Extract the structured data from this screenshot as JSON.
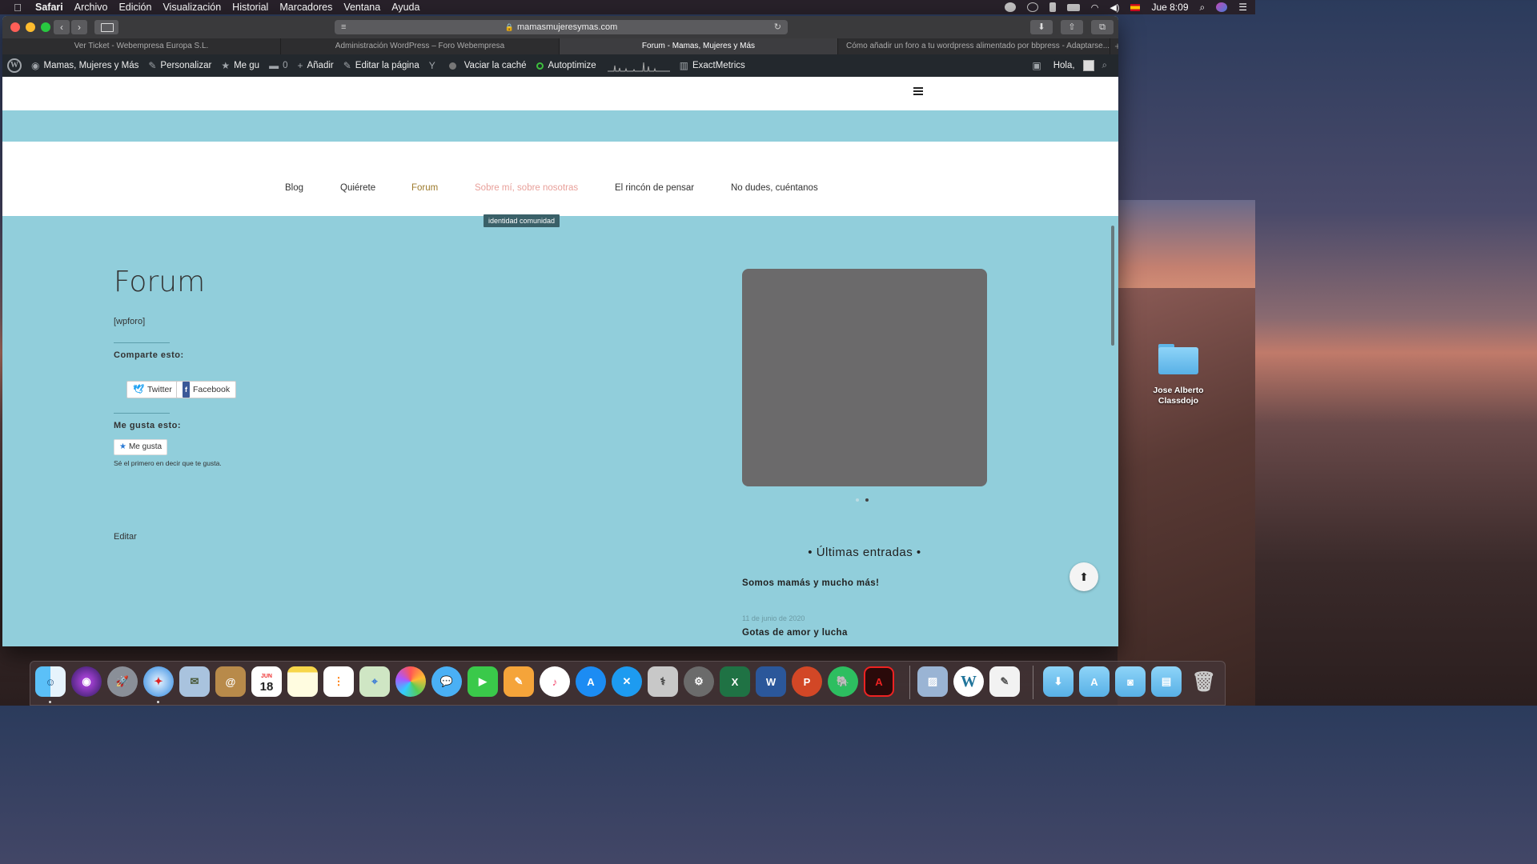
{
  "menubar": {
    "apple": "",
    "items": [
      "Safari",
      "Archivo",
      "Edición",
      "Visualización",
      "Historial",
      "Marcadores",
      "Ventana",
      "Ayuda"
    ],
    "clock": "Jue 8:09"
  },
  "browser": {
    "address": "mamasmujeresymas.com",
    "tabs": [
      {
        "label": "Ver Ticket - Webempresa Europa S.L."
      },
      {
        "label": "Administración WordPress – Foro Webempresa"
      },
      {
        "label": "Forum - Mamas, Mujeres y Más"
      },
      {
        "label": "Cómo añadir un foro a tu wordpress alimentado por bbpress - Adaptarse..."
      }
    ],
    "active_tab": 2
  },
  "wpbar": {
    "site": "Mamas, Mujeres y Más",
    "customize": "Personalizar",
    "me_gusta": "Me gu",
    "comments": "0",
    "add": "Añadir",
    "edit_page": "Editar la página",
    "clear_cache": "Vaciar la caché",
    "autoptimize": "Autoptimize",
    "exactmetrics": "ExactMetrics",
    "hello": "Hola,"
  },
  "nav": {
    "items": [
      "Blog",
      "Quiérete",
      "Forum",
      "Sobre mí, sobre nosotras",
      "El rincón de pensar",
      "No dudes, cuéntanos"
    ],
    "tooltip": "identidad comunidad"
  },
  "content": {
    "title": "Forum",
    "shortcode": "[wpforo]",
    "share_heading": "Comparte esto:",
    "twitter": "Twitter",
    "facebook": "Facebook",
    "like_heading": "Me gusta esto:",
    "like_button": "Me gusta",
    "like_note": "Sé el primero en decir que te gusta.",
    "edit": "Editar"
  },
  "sidebar": {
    "widget_title": "Últimas entradas",
    "posts": [
      {
        "title": "Somos mamás y mucho más!",
        "date": "11 de junio de 2020"
      },
      {
        "title": "Gotas de amor y lucha"
      }
    ]
  },
  "desktop": {
    "folder_label": "Jose Alberto Classdojo"
  },
  "dock": {
    "calendar_month": "JUN",
    "calendar_day": "18"
  },
  "colors": {
    "page_bg": "#91cedb",
    "nav_active": "#9c7a2b",
    "nav_hover": "#e8a09a"
  }
}
